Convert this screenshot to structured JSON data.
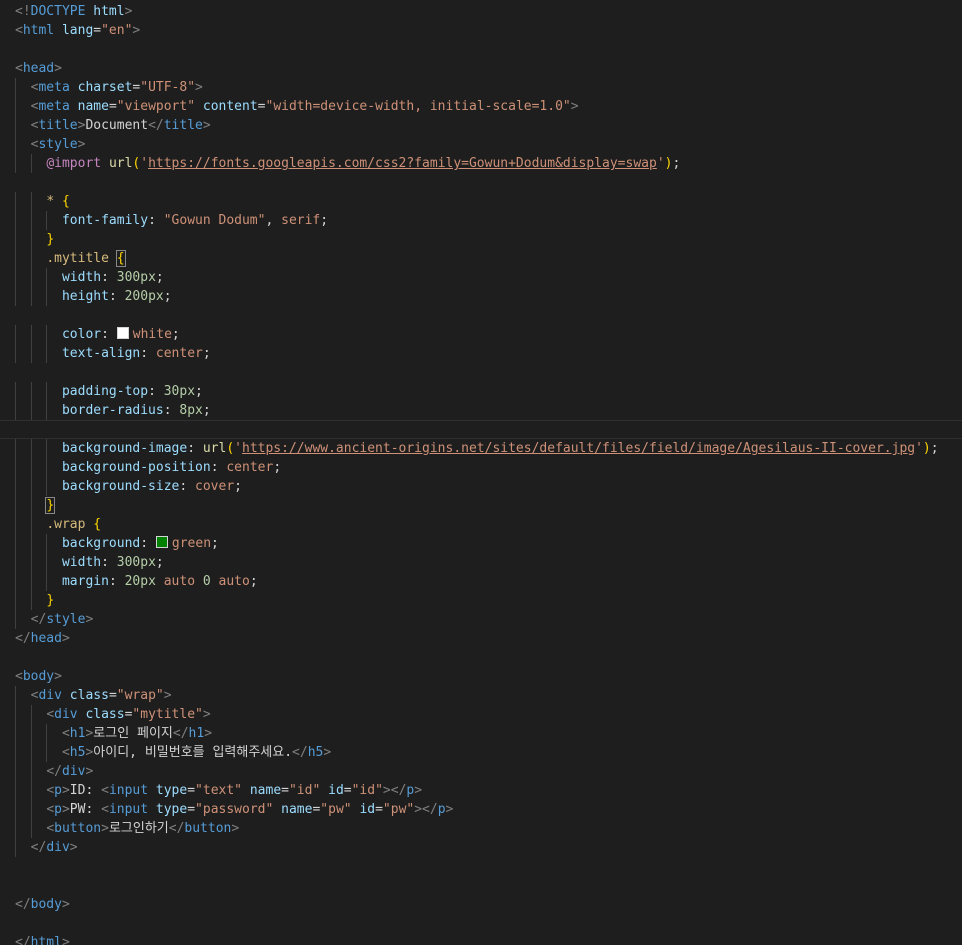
{
  "editor": {
    "language": "html",
    "theme": "dark",
    "lines": [
      [
        [
          "p",
          "<!"
        ],
        [
          "tg",
          "DOCTYPE"
        ],
        [
          "tx",
          " "
        ],
        [
          "at",
          "html"
        ],
        [
          "p",
          ">"
        ]
      ],
      [
        [
          "p",
          "<"
        ],
        [
          "tg",
          "html"
        ],
        [
          "tx",
          " "
        ],
        [
          "at",
          "lang"
        ],
        [
          "tx",
          "="
        ],
        [
          "st",
          "\"en\""
        ],
        [
          "p",
          ">"
        ]
      ],
      [],
      [
        [
          "p",
          "<"
        ],
        [
          "tg",
          "head"
        ],
        [
          "p",
          ">"
        ]
      ],
      [
        [
          "tx",
          "  "
        ],
        [
          "p",
          "<"
        ],
        [
          "tg",
          "meta"
        ],
        [
          "tx",
          " "
        ],
        [
          "at",
          "charset"
        ],
        [
          "tx",
          "="
        ],
        [
          "st",
          "\"UTF-8\""
        ],
        [
          "p",
          ">"
        ]
      ],
      [
        [
          "tx",
          "  "
        ],
        [
          "p",
          "<"
        ],
        [
          "tg",
          "meta"
        ],
        [
          "tx",
          " "
        ],
        [
          "at",
          "name"
        ],
        [
          "tx",
          "="
        ],
        [
          "st",
          "\"viewport\""
        ],
        [
          "tx",
          " "
        ],
        [
          "at",
          "content"
        ],
        [
          "tx",
          "="
        ],
        [
          "st",
          "\"width=device-width, initial-scale=1.0\""
        ],
        [
          "p",
          ">"
        ]
      ],
      [
        [
          "tx",
          "  "
        ],
        [
          "p",
          "<"
        ],
        [
          "tg",
          "title"
        ],
        [
          "p",
          ">"
        ],
        [
          "tx",
          "Document"
        ],
        [
          "p",
          "</"
        ],
        [
          "tg",
          "title"
        ],
        [
          "p",
          ">"
        ]
      ],
      [
        [
          "tx",
          "  "
        ],
        [
          "p",
          "<"
        ],
        [
          "tg",
          "style"
        ],
        [
          "p",
          ">"
        ]
      ],
      [
        [
          "tx",
          "    "
        ],
        [
          "kw",
          "@import"
        ],
        [
          "tx",
          " "
        ],
        [
          "fn",
          "url"
        ],
        [
          "br",
          "("
        ],
        [
          "st",
          "'"
        ],
        [
          "st url",
          "https://fonts.googleapis.com/css2?family=Gowun+Dodum&display=swap"
        ],
        [
          "st",
          "'"
        ],
        [
          "br",
          ")"
        ],
        [
          "tx",
          ";"
        ]
      ],
      [],
      [
        [
          "tx",
          "    "
        ],
        [
          "sel",
          "*"
        ],
        [
          "tx",
          " "
        ],
        [
          "br",
          "{"
        ]
      ],
      [
        [
          "tx",
          "      "
        ],
        [
          "at",
          "font-family"
        ],
        [
          "tx",
          ": "
        ],
        [
          "st",
          "\"Gowun Dodum\""
        ],
        [
          "tx",
          ", "
        ],
        [
          "st",
          "serif"
        ],
        [
          "tx",
          ";"
        ]
      ],
      [
        [
          "tx",
          "    "
        ],
        [
          "br",
          "}"
        ]
      ],
      [
        [
          "tx",
          "    "
        ],
        [
          "sel",
          ".mytitle"
        ],
        [
          "tx",
          " "
        ],
        [
          "br bracket-match",
          "{"
        ]
      ],
      [
        [
          "tx",
          "      "
        ],
        [
          "at",
          "width"
        ],
        [
          "tx",
          ": "
        ],
        [
          "nm",
          "300px"
        ],
        [
          "tx",
          ";"
        ]
      ],
      [
        [
          "tx",
          "      "
        ],
        [
          "at",
          "height"
        ],
        [
          "tx",
          ": "
        ],
        [
          "nm",
          "200px"
        ],
        [
          "tx",
          ";"
        ]
      ],
      [],
      [
        [
          "tx",
          "      "
        ],
        [
          "at",
          "color"
        ],
        [
          "tx",
          ": "
        ],
        [
          "swatch",
          "white"
        ],
        [
          "st",
          "white"
        ],
        [
          "tx",
          ";"
        ]
      ],
      [
        [
          "tx",
          "      "
        ],
        [
          "at",
          "text-align"
        ],
        [
          "tx",
          ": "
        ],
        [
          "st",
          "center"
        ],
        [
          "tx",
          ";"
        ]
      ],
      [],
      [
        [
          "tx",
          "      "
        ],
        [
          "at",
          "padding-top"
        ],
        [
          "tx",
          ": "
        ],
        [
          "nm",
          "30px"
        ],
        [
          "tx",
          ";"
        ]
      ],
      [
        [
          "tx",
          "      "
        ],
        [
          "at",
          "border-radius"
        ],
        [
          "tx",
          ": "
        ],
        [
          "nm",
          "8px"
        ],
        [
          "tx",
          ";"
        ]
      ],
      [],
      [
        [
          "tx",
          "      "
        ],
        [
          "at",
          "background-image"
        ],
        [
          "tx",
          ": "
        ],
        [
          "fn",
          "url"
        ],
        [
          "br",
          "("
        ],
        [
          "st",
          "'"
        ],
        [
          "st url",
          "https://www.ancient-origins.net/sites/default/files/field/image/Agesilaus-II-cover.jpg"
        ],
        [
          "st",
          "'"
        ],
        [
          "br",
          ")"
        ],
        [
          "tx",
          ";"
        ]
      ],
      [
        [
          "tx",
          "      "
        ],
        [
          "at",
          "background-position"
        ],
        [
          "tx",
          ": "
        ],
        [
          "st",
          "center"
        ],
        [
          "tx",
          ";"
        ]
      ],
      [
        [
          "tx",
          "      "
        ],
        [
          "at",
          "background-size"
        ],
        [
          "tx",
          ": "
        ],
        [
          "st",
          "cover"
        ],
        [
          "tx",
          ";"
        ]
      ],
      [
        [
          "tx",
          "    "
        ],
        [
          "br bracket-match",
          "}"
        ]
      ],
      [
        [
          "tx",
          "    "
        ],
        [
          "sel",
          ".wrap"
        ],
        [
          "tx",
          " "
        ],
        [
          "br",
          "{"
        ]
      ],
      [
        [
          "tx",
          "      "
        ],
        [
          "at",
          "background"
        ],
        [
          "tx",
          ": "
        ],
        [
          "swatch",
          "green"
        ],
        [
          "st",
          "green"
        ],
        [
          "tx",
          ";"
        ]
      ],
      [
        [
          "tx",
          "      "
        ],
        [
          "at",
          "width"
        ],
        [
          "tx",
          ": "
        ],
        [
          "nm",
          "300px"
        ],
        [
          "tx",
          ";"
        ]
      ],
      [
        [
          "tx",
          "      "
        ],
        [
          "at",
          "margin"
        ],
        [
          "tx",
          ": "
        ],
        [
          "nm",
          "20px"
        ],
        [
          "tx",
          " "
        ],
        [
          "st",
          "auto"
        ],
        [
          "tx",
          " "
        ],
        [
          "nm",
          "0"
        ],
        [
          "tx",
          " "
        ],
        [
          "st",
          "auto"
        ],
        [
          "tx",
          ";"
        ]
      ],
      [
        [
          "tx",
          "    "
        ],
        [
          "br",
          "}"
        ]
      ],
      [
        [
          "tx",
          "  "
        ],
        [
          "p",
          "</"
        ],
        [
          "tg",
          "style"
        ],
        [
          "p",
          ">"
        ]
      ],
      [
        [
          "p",
          "</"
        ],
        [
          "tg",
          "head"
        ],
        [
          "p",
          ">"
        ]
      ],
      [],
      [
        [
          "p",
          "<"
        ],
        [
          "tg",
          "body"
        ],
        [
          "p",
          ">"
        ]
      ],
      [
        [
          "tx",
          "  "
        ],
        [
          "p",
          "<"
        ],
        [
          "tg",
          "div"
        ],
        [
          "tx",
          " "
        ],
        [
          "at",
          "class"
        ],
        [
          "tx",
          "="
        ],
        [
          "st",
          "\"wrap\""
        ],
        [
          "p",
          ">"
        ]
      ],
      [
        [
          "tx",
          "    "
        ],
        [
          "p",
          "<"
        ],
        [
          "tg",
          "div"
        ],
        [
          "tx",
          " "
        ],
        [
          "at",
          "class"
        ],
        [
          "tx",
          "="
        ],
        [
          "st",
          "\"mytitle\""
        ],
        [
          "p",
          ">"
        ]
      ],
      [
        [
          "tx",
          "      "
        ],
        [
          "p",
          "<"
        ],
        [
          "tg",
          "h1"
        ],
        [
          "p",
          ">"
        ],
        [
          "tx",
          "로그인 페이지"
        ],
        [
          "p",
          "</"
        ],
        [
          "tg",
          "h1"
        ],
        [
          "p",
          ">"
        ]
      ],
      [
        [
          "tx",
          "      "
        ],
        [
          "p",
          "<"
        ],
        [
          "tg",
          "h5"
        ],
        [
          "p",
          ">"
        ],
        [
          "tx",
          "아이디, 비밀번호를 입력해주세요."
        ],
        [
          "p",
          "</"
        ],
        [
          "tg",
          "h5"
        ],
        [
          "p",
          ">"
        ]
      ],
      [
        [
          "tx",
          "    "
        ],
        [
          "p",
          "</"
        ],
        [
          "tg",
          "div"
        ],
        [
          "p",
          ">"
        ]
      ],
      [
        [
          "tx",
          "    "
        ],
        [
          "p",
          "<"
        ],
        [
          "tg",
          "p"
        ],
        [
          "p",
          ">"
        ],
        [
          "tx",
          "ID: "
        ],
        [
          "p",
          "<"
        ],
        [
          "tg",
          "input"
        ],
        [
          "tx",
          " "
        ],
        [
          "at",
          "type"
        ],
        [
          "tx",
          "="
        ],
        [
          "st",
          "\"text\""
        ],
        [
          "tx",
          " "
        ],
        [
          "at",
          "name"
        ],
        [
          "tx",
          "="
        ],
        [
          "st",
          "\"id\""
        ],
        [
          "tx",
          " "
        ],
        [
          "at",
          "id"
        ],
        [
          "tx",
          "="
        ],
        [
          "st",
          "\"id\""
        ],
        [
          "p",
          "></"
        ],
        [
          "tg",
          "p"
        ],
        [
          "p",
          ">"
        ]
      ],
      [
        [
          "tx",
          "    "
        ],
        [
          "p",
          "<"
        ],
        [
          "tg",
          "p"
        ],
        [
          "p",
          ">"
        ],
        [
          "tx",
          "PW: "
        ],
        [
          "p",
          "<"
        ],
        [
          "tg",
          "input"
        ],
        [
          "tx",
          " "
        ],
        [
          "at",
          "type"
        ],
        [
          "tx",
          "="
        ],
        [
          "st",
          "\"password\""
        ],
        [
          "tx",
          " "
        ],
        [
          "at",
          "name"
        ],
        [
          "tx",
          "="
        ],
        [
          "st",
          "\"pw\""
        ],
        [
          "tx",
          " "
        ],
        [
          "at",
          "id"
        ],
        [
          "tx",
          "="
        ],
        [
          "st",
          "\"pw\""
        ],
        [
          "p",
          "></"
        ],
        [
          "tg",
          "p"
        ],
        [
          "p",
          ">"
        ]
      ],
      [
        [
          "tx",
          "    "
        ],
        [
          "p",
          "<"
        ],
        [
          "tg",
          "button"
        ],
        [
          "p",
          ">"
        ],
        [
          "tx",
          "로그인하기"
        ],
        [
          "p",
          "</"
        ],
        [
          "tg",
          "button"
        ],
        [
          "p",
          ">"
        ]
      ],
      [
        [
          "tx",
          "  "
        ],
        [
          "p",
          "</"
        ],
        [
          "tg",
          "div"
        ],
        [
          "p",
          ">"
        ]
      ],
      [],
      [],
      [
        [
          "p",
          "</"
        ],
        [
          "tg",
          "body"
        ],
        [
          "p",
          ">"
        ]
      ],
      [],
      [
        [
          "p",
          "</"
        ],
        [
          "tg",
          "html"
        ],
        [
          "p",
          ">"
        ]
      ]
    ]
  }
}
